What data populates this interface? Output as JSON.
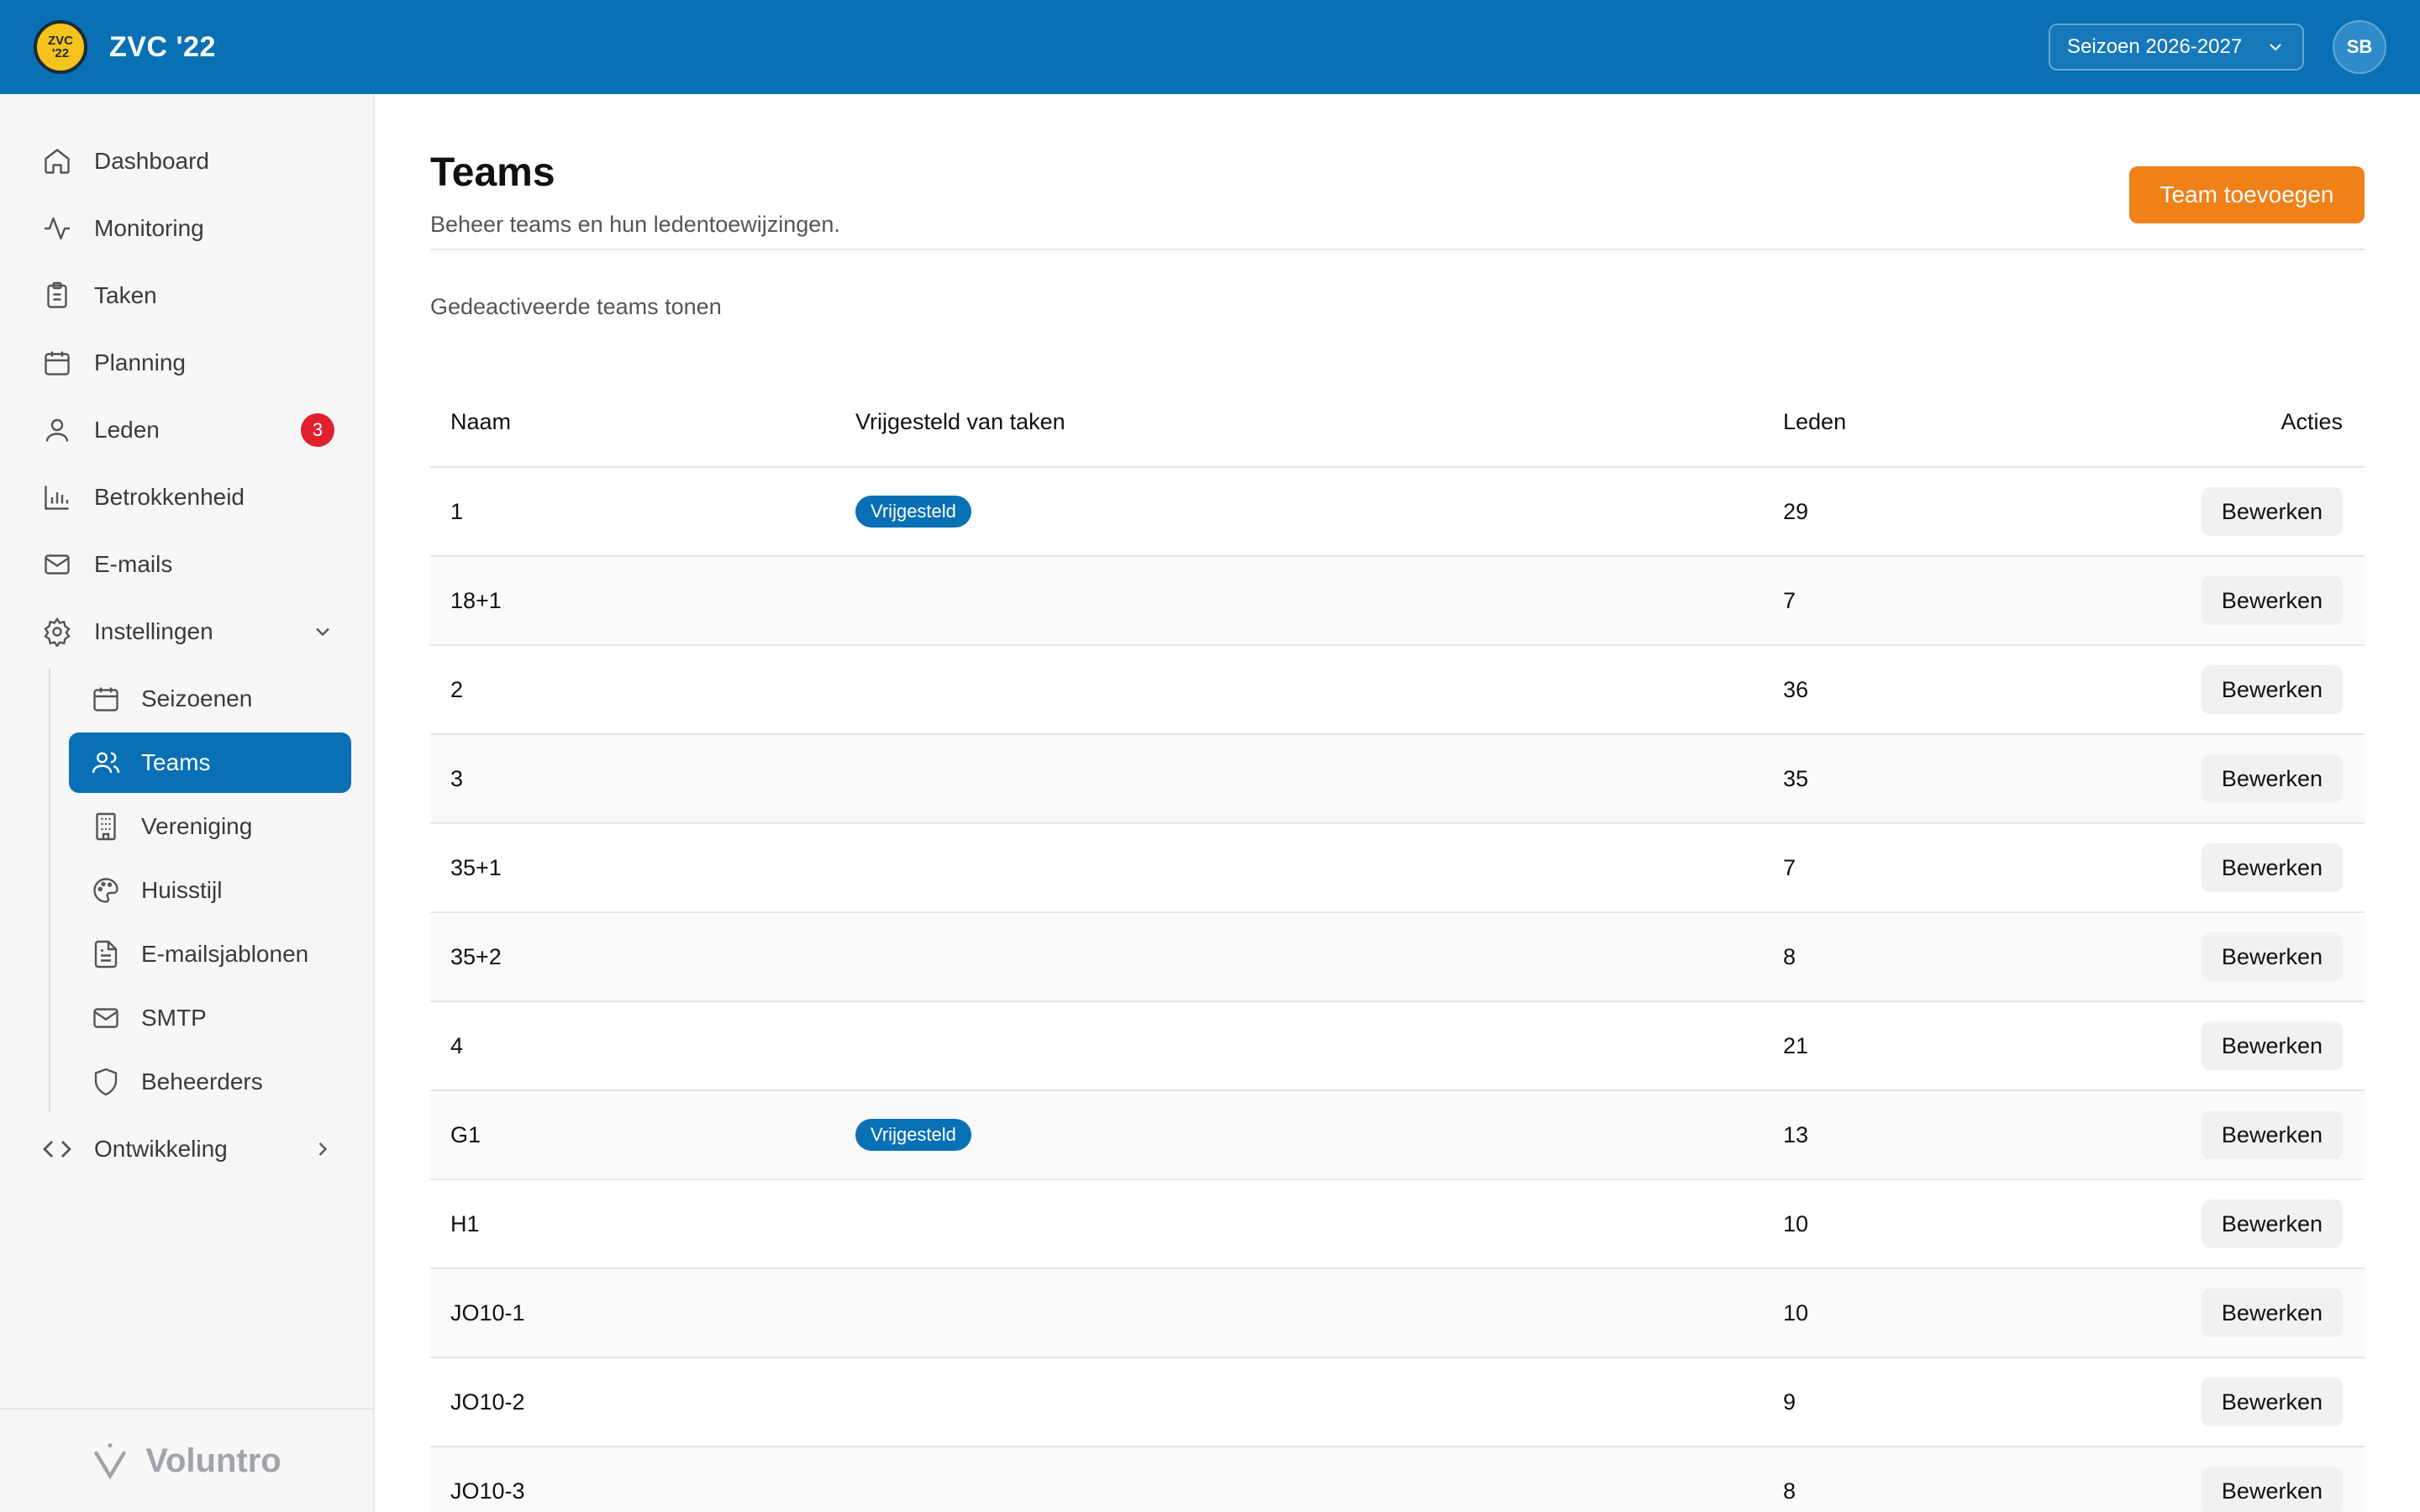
{
  "app": {
    "logo_line1": "ZVC",
    "logo_line2": "'22",
    "title": "ZVC '22",
    "season": "Seizoen 2026-2027",
    "user_initials": "SB"
  },
  "sidebar": {
    "items": [
      {
        "label": "Dashboard",
        "icon": "home-icon"
      },
      {
        "label": "Monitoring",
        "icon": "activity-icon"
      },
      {
        "label": "Taken",
        "icon": "clipboard-icon"
      },
      {
        "label": "Planning",
        "icon": "calendar-icon"
      },
      {
        "label": "Leden",
        "icon": "user-icon",
        "badge": "3"
      },
      {
        "label": "Betrokkenheid",
        "icon": "bar-chart-icon"
      },
      {
        "label": "E-mails",
        "icon": "mail-icon"
      },
      {
        "label": "Instellingen",
        "icon": "gear-icon"
      }
    ],
    "settings_sub": [
      {
        "label": "Seizoenen",
        "icon": "calendar-icon"
      },
      {
        "label": "Teams",
        "icon": "users-icon",
        "active": true
      },
      {
        "label": "Vereniging",
        "icon": "building-icon"
      },
      {
        "label": "Huisstijl",
        "icon": "palette-icon"
      },
      {
        "label": "E-mailsjablonen",
        "icon": "file-text-icon"
      },
      {
        "label": "SMTP",
        "icon": "mail-icon"
      },
      {
        "label": "Beheerders",
        "icon": "shield-icon"
      }
    ],
    "dev": {
      "label": "Ontwikkeling",
      "icon": "code-icon"
    },
    "footer_brand": "Voluntro"
  },
  "page": {
    "title": "Teams",
    "subtitle": "Beheer teams en hun ledentoewijzingen.",
    "add_button": "Team toevoegen",
    "toggle_label": "Gedeactiveerde teams tonen"
  },
  "table": {
    "headers": [
      "Naam",
      "Vrijgesteld van taken",
      "Leden",
      "Acties"
    ],
    "exempt_label": "Vrijgesteld",
    "action_label": "Bewerken",
    "rows": [
      {
        "name": "1",
        "exempt": true,
        "members": "29"
      },
      {
        "name": "18+1",
        "exempt": false,
        "members": "7"
      },
      {
        "name": "2",
        "exempt": false,
        "members": "36"
      },
      {
        "name": "3",
        "exempt": false,
        "members": "35"
      },
      {
        "name": "35+1",
        "exempt": false,
        "members": "7"
      },
      {
        "name": "35+2",
        "exempt": false,
        "members": "8"
      },
      {
        "name": "4",
        "exempt": false,
        "members": "21"
      },
      {
        "name": "G1",
        "exempt": true,
        "members": "13"
      },
      {
        "name": "H1",
        "exempt": false,
        "members": "10"
      },
      {
        "name": "JO10-1",
        "exempt": false,
        "members": "10"
      },
      {
        "name": "JO10-2",
        "exempt": false,
        "members": "9"
      },
      {
        "name": "JO10-3",
        "exempt": false,
        "members": "8"
      }
    ]
  },
  "colors": {
    "brand": "#0870b5",
    "accent": "#f08018",
    "badge": "#e0202e"
  }
}
